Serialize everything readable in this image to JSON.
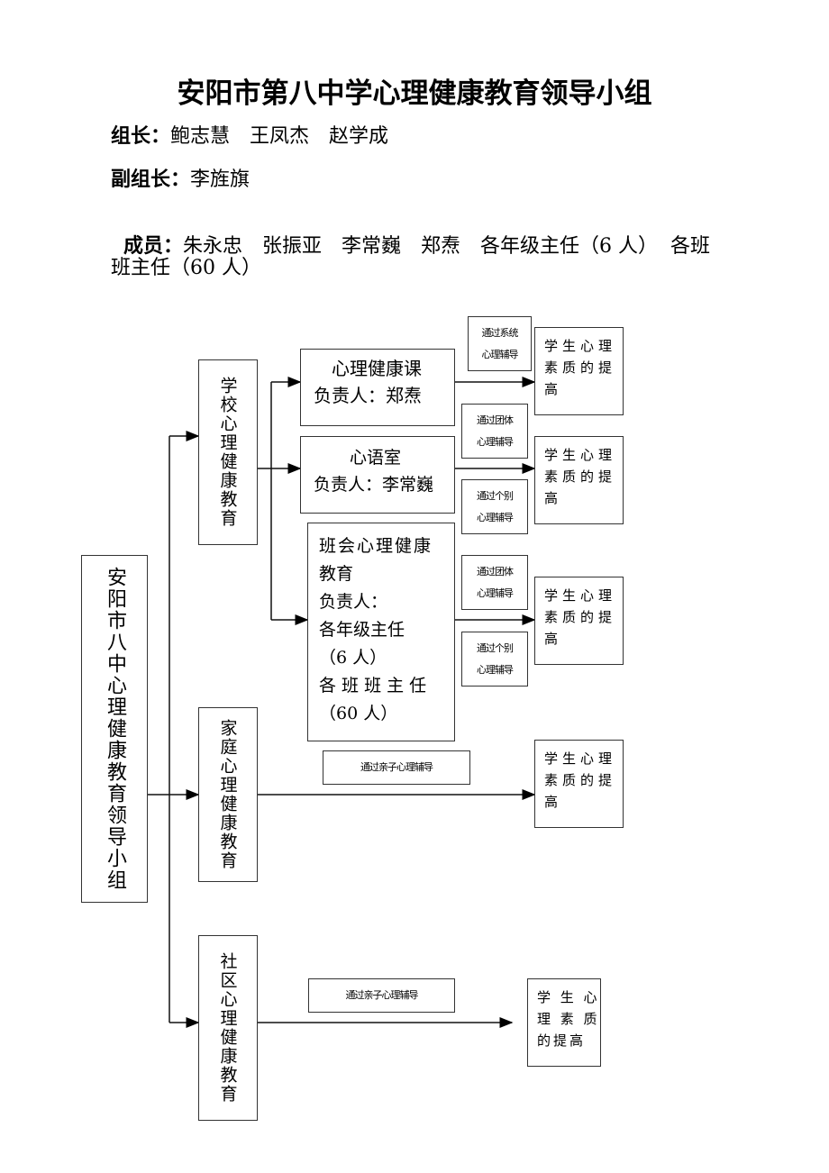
{
  "title": "安阳市第八中学心理健康教育领导小组",
  "leaders": {
    "label": "组长：",
    "names": "鲍志慧　王凤杰　赵学成"
  },
  "deputy": {
    "label": "副组长：",
    "names": "李旌旗"
  },
  "members": {
    "label": "成员：",
    "line1": "朱永忠　张振亚　李常巍　郑焘　各年级主任（6 人）  各班",
    "line2": "班主任（60 人）"
  },
  "chart": {
    "root": "安阳市八中心理健康教育领导小组",
    "school": "学校心理健康教育",
    "family": "家庭心理健康教育",
    "community": "社区心理健康教育",
    "course": {
      "name": "心理健康课",
      "owner": "负责人：郑焘"
    },
    "room": {
      "name": "心语室",
      "owner": "负责人：李常巍"
    },
    "classmeeting": {
      "l1": "班会心理健康",
      "l2": "教育",
      "l3": "负责人：",
      "l4": "各年级主任",
      "l5": "（6 人）",
      "l6": "各 班 班 主 任",
      "l7": "（60 人）"
    },
    "methods": {
      "system": [
        "通过系统",
        "心理辅导"
      ],
      "group": [
        "通过团体",
        "心理辅导"
      ],
      "individual": [
        "通过个别",
        "心理辅导"
      ],
      "parent": "通过亲子心理辅导"
    },
    "result_lines": [
      "学生心理",
      "素质的提",
      "高"
    ],
    "result_lines_last": [
      "学 生 心",
      "理 素 质",
      "的提高"
    ]
  }
}
